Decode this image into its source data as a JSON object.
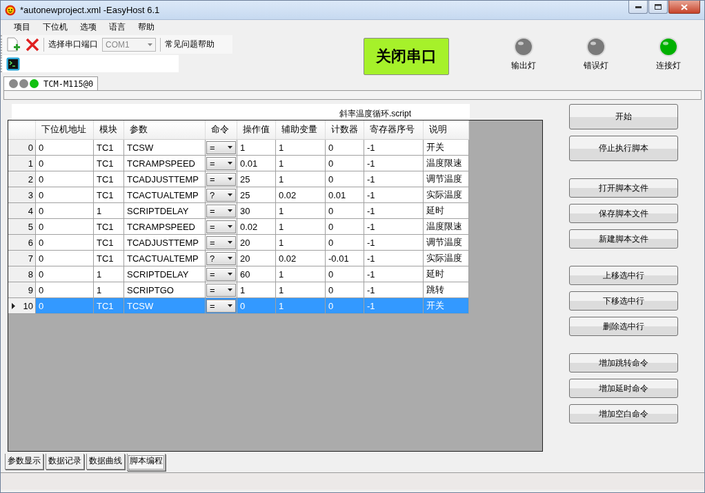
{
  "window": {
    "title": "*autonewproject.xml -EasyHost 6.1"
  },
  "menu": [
    "项目",
    "下位机",
    "选项",
    "语言",
    "帮助"
  ],
  "toolbar": {
    "port_label": "选择串口端口",
    "port_value": "COM1",
    "help": "常见问题帮助"
  },
  "serial_button": "关闭串口",
  "lights": [
    {
      "label": "输出灯",
      "color": "#7a7a7a"
    },
    {
      "label": "错误灯",
      "color": "#7a7a7a"
    },
    {
      "label": "连接灯",
      "color": "#00b000"
    }
  ],
  "device_tab": {
    "label": "TCM-M115@0",
    "leds": [
      {
        "color": "#8a8a8a"
      },
      {
        "color": "#8a8a8a"
      },
      {
        "color": "#10c010"
      }
    ]
  },
  "script_title": "斜率温度循环.script",
  "table": {
    "columns": [
      "下位机地址",
      "模块",
      "参数",
      "命令",
      "操作值",
      "辅助变量",
      "计数器",
      "寄存器序号",
      "说明"
    ],
    "rows": [
      {
        "index": "0",
        "cells": [
          "0",
          "TC1",
          "TCSW",
          "=",
          "1",
          "1",
          "0",
          "-1",
          "开关"
        ],
        "selected": false
      },
      {
        "index": "1",
        "cells": [
          "0",
          "TC1",
          "TCRAMPSPEED",
          "=",
          "0.01",
          "1",
          "0",
          "-1",
          "温度限速"
        ],
        "selected": false
      },
      {
        "index": "2",
        "cells": [
          "0",
          "TC1",
          "TCADJUSTTEMP",
          "=",
          "25",
          "1",
          "0",
          "-1",
          "调节温度"
        ],
        "selected": false
      },
      {
        "index": "3",
        "cells": [
          "0",
          "TC1",
          "TCACTUALTEMP",
          "?",
          "25",
          "0.02",
          "0.01",
          "-1",
          "实际温度"
        ],
        "selected": false
      },
      {
        "index": "4",
        "cells": [
          "0",
          "1",
          "SCRIPTDELAY",
          "=",
          "30",
          "1",
          "0",
          "-1",
          "延时"
        ],
        "selected": false
      },
      {
        "index": "5",
        "cells": [
          "0",
          "TC1",
          "TCRAMPSPEED",
          "=",
          "0.02",
          "1",
          "0",
          "-1",
          "温度限速"
        ],
        "selected": false
      },
      {
        "index": "6",
        "cells": [
          "0",
          "TC1",
          "TCADJUSTTEMP",
          "=",
          "20",
          "1",
          "0",
          "-1",
          "调节温度"
        ],
        "selected": false
      },
      {
        "index": "7",
        "cells": [
          "0",
          "TC1",
          "TCACTUALTEMP",
          "?",
          "20",
          "0.02",
          "-0.01",
          "-1",
          "实际温度"
        ],
        "selected": false
      },
      {
        "index": "8",
        "cells": [
          "0",
          "1",
          "SCRIPTDELAY",
          "=",
          "60",
          "1",
          "0",
          "-1",
          "延时"
        ],
        "selected": false
      },
      {
        "index": "9",
        "cells": [
          "0",
          "1",
          "SCRIPTGO",
          "=",
          "1",
          "1",
          "0",
          "-1",
          "跳转"
        ],
        "selected": false
      },
      {
        "index": "10",
        "cells": [
          "0",
          "TC1",
          "TCSW",
          "=",
          "0",
          "1",
          "0",
          "-1",
          "开关"
        ],
        "selected": true
      }
    ]
  },
  "button_groups": [
    [
      "开始",
      "停止执行脚本"
    ],
    [
      "打开脚本文件",
      "保存脚本文件",
      "新建脚本文件"
    ],
    [
      "上移选中行",
      "下移选中行",
      "删除选中行"
    ],
    [
      "增加跳转命令",
      "增加延时命令",
      "增加空白命令"
    ]
  ],
  "bottom_tabs": [
    {
      "label": "参数显示",
      "selected": false
    },
    {
      "label": "数据记录",
      "selected": false
    },
    {
      "label": "数据曲线",
      "selected": false
    },
    {
      "label": "脚本编程",
      "selected": true
    }
  ]
}
